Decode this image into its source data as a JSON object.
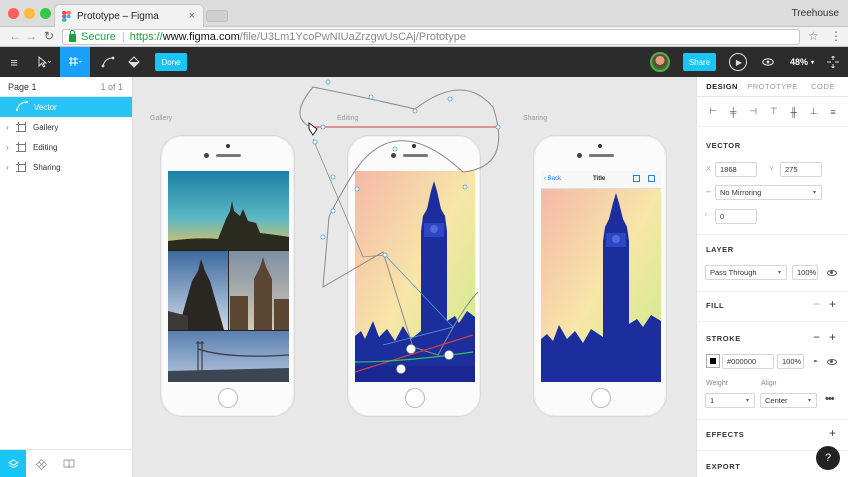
{
  "browser": {
    "tab_title": "Prototype – Figma",
    "tab_close": "×",
    "profile": "Treehouse",
    "secure_label": "Secure",
    "url_protocol": "https://",
    "url_host": "www.figma.com",
    "url_path": "/file/U3Lm1YcoPwNIUaZrzgwUsCAj/Prototype",
    "colors": {
      "close": "#fc605c",
      "minimize": "#fdbc40",
      "zoom": "#34c84a"
    }
  },
  "toolbar": {
    "done_label": "Done",
    "share_label": "Share",
    "zoom_label": "48%",
    "accent": "#18a0fb"
  },
  "left_panel": {
    "page_name": "Page 1",
    "page_count": "1 of 1",
    "layers": [
      {
        "label": "Vector",
        "selected": true
      },
      {
        "label": "Gallery",
        "selected": false
      },
      {
        "label": "Editing",
        "selected": false
      },
      {
        "label": "Sharing",
        "selected": false
      }
    ]
  },
  "canvas": {
    "frames": [
      {
        "label": "Gallery"
      },
      {
        "label": "Editing"
      },
      {
        "label": "Sharing"
      }
    ],
    "sharing_nav": {
      "back": "Back",
      "title": "Title"
    }
  },
  "right_panel": {
    "tabs": [
      "DESIGN",
      "PROTOTYPE",
      "CODE"
    ],
    "vector": {
      "title": "VECTOR",
      "x_label": "X",
      "x_value": "1868",
      "y_label": "Y",
      "y_value": "275",
      "mirroring": "No Mirroring",
      "corner_radius": "0"
    },
    "layer": {
      "title": "LAYER",
      "blend": "Pass Through",
      "opacity": "100%"
    },
    "fill": {
      "title": "FILL"
    },
    "stroke": {
      "title": "STROKE",
      "color": "#000000",
      "opacity": "100%",
      "weight_label": "Weight",
      "weight": "1",
      "align_label": "Align",
      "align": "Center"
    },
    "effects": {
      "title": "EFFECTS"
    },
    "export": {
      "title": "EXPORT"
    }
  },
  "help_label": "?"
}
